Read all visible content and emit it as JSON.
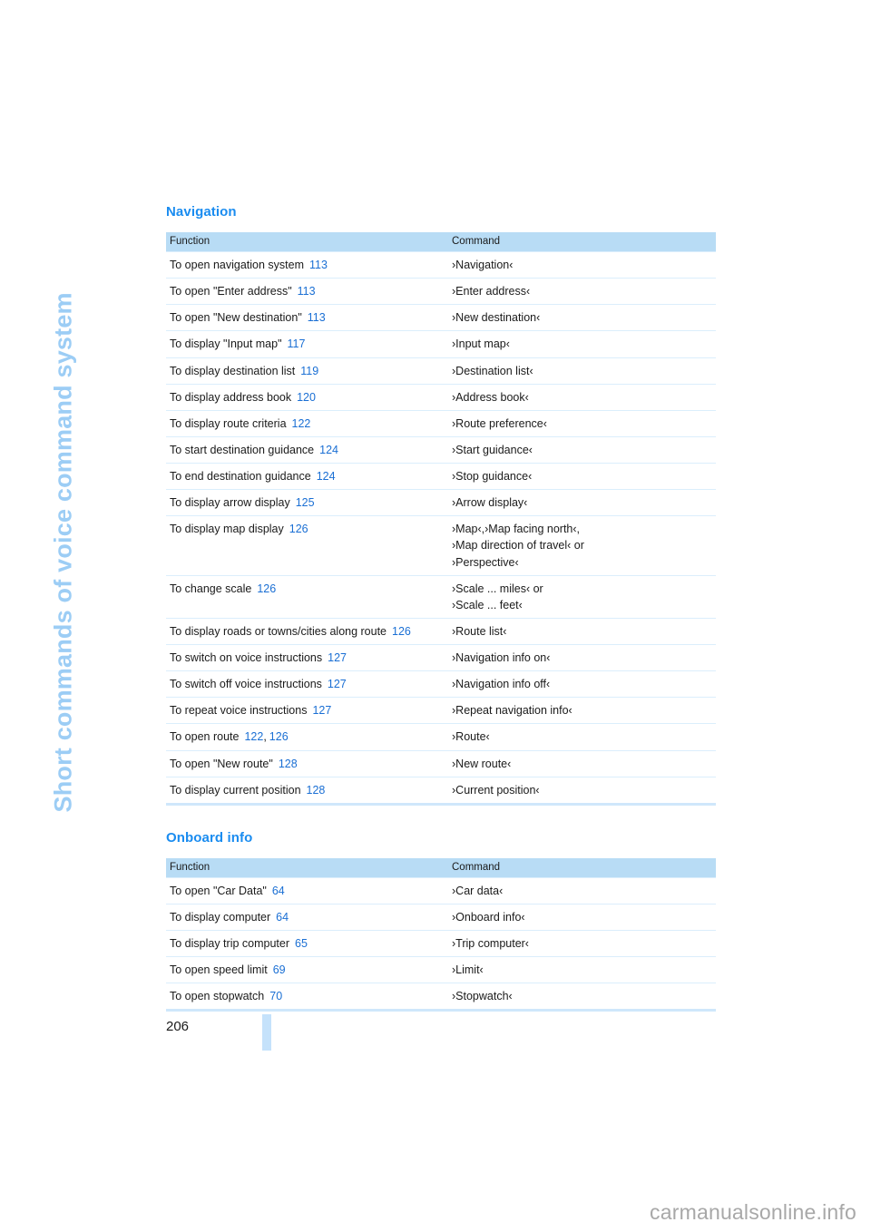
{
  "chapter": {
    "title": "Short commands of voice command system"
  },
  "sections": [
    {
      "heading": "Navigation",
      "columns": {
        "function": "Function",
        "command": "Command"
      },
      "rows": [
        {
          "function": "To open navigation system",
          "refs": [
            "113"
          ],
          "command": [
            "›Navigation‹"
          ]
        },
        {
          "function": "To open \"Enter address\"",
          "refs": [
            "113"
          ],
          "command": [
            "›Enter address‹"
          ]
        },
        {
          "function": "To open \"New destination\"",
          "refs": [
            "113"
          ],
          "command": [
            "›New destination‹"
          ]
        },
        {
          "function": "To display \"Input map\"",
          "refs": [
            "117"
          ],
          "command": [
            "›Input map‹"
          ]
        },
        {
          "function": "To display destination list",
          "refs": [
            "119"
          ],
          "command": [
            "›Destination list‹"
          ]
        },
        {
          "function": "To display address book",
          "refs": [
            "120"
          ],
          "command": [
            "›Address book‹"
          ]
        },
        {
          "function": "To display route criteria",
          "refs": [
            "122"
          ],
          "command": [
            "›Route preference‹"
          ]
        },
        {
          "function": "To start destination guidance",
          "refs": [
            "124"
          ],
          "command": [
            "›Start guidance‹"
          ]
        },
        {
          "function": "To end destination guidance",
          "refs": [
            "124"
          ],
          "command": [
            "›Stop guidance‹"
          ]
        },
        {
          "function": "To display arrow display",
          "refs": [
            "125"
          ],
          "command": [
            "›Arrow display‹"
          ]
        },
        {
          "function": "To display map display",
          "refs": [
            "126"
          ],
          "command": [
            "›Map‹,›Map facing north‹,",
            "›Map direction of travel‹ or",
            "›Perspective‹"
          ]
        },
        {
          "function": "To change scale",
          "refs": [
            "126"
          ],
          "command": [
            "›Scale ... miles‹ or",
            "›Scale ... feet‹"
          ]
        },
        {
          "function": "To display roads or towns/cities along route",
          "refs": [
            "126"
          ],
          "command": [
            "›Route list‹"
          ]
        },
        {
          "function": "To switch on voice instructions",
          "refs": [
            "127"
          ],
          "command": [
            "›Navigation info on‹"
          ]
        },
        {
          "function": "To switch off voice instructions",
          "refs": [
            "127"
          ],
          "command": [
            "›Navigation info off‹"
          ]
        },
        {
          "function": "To repeat voice instructions",
          "refs": [
            "127"
          ],
          "command": [
            "›Repeat navigation info‹"
          ]
        },
        {
          "function": "To open route",
          "refs": [
            "122",
            "126"
          ],
          "command": [
            "›Route‹"
          ]
        },
        {
          "function": "To open \"New route\"",
          "refs": [
            "128"
          ],
          "command": [
            "›New route‹"
          ]
        },
        {
          "function": "To display current position",
          "refs": [
            "128"
          ],
          "command": [
            "›Current position‹"
          ]
        }
      ]
    },
    {
      "heading": "Onboard info",
      "columns": {
        "function": "Function",
        "command": "Command"
      },
      "rows": [
        {
          "function": "To open \"Car Data\"",
          "refs": [
            "64"
          ],
          "command": [
            "›Car data‹"
          ]
        },
        {
          "function": "To display computer",
          "refs": [
            "64"
          ],
          "command": [
            "›Onboard info‹"
          ]
        },
        {
          "function": "To display trip computer",
          "refs": [
            "65"
          ],
          "command": [
            "›Trip computer‹"
          ]
        },
        {
          "function": "To open speed limit",
          "refs": [
            "69"
          ],
          "command": [
            "›Limit‹"
          ]
        },
        {
          "function": "To open stopwatch",
          "refs": [
            "70"
          ],
          "command": [
            "›Stopwatch‹"
          ]
        }
      ]
    }
  ],
  "footer": {
    "page_number": "206"
  },
  "watermark": {
    "text": "carmanualsonline.info"
  },
  "colors": {
    "heading_blue": "#1a8cf0",
    "table_header_bg": "#b8dcf5",
    "page_ref_blue": "#1a6fd4",
    "chapter_title_blue": "#9ccdf5",
    "row_rule": "#dbeefc",
    "table_bottom_rule": "#cfe7fb",
    "footer_bar": "#c5e2fb",
    "watermark_gray": "#a8a8a8"
  }
}
